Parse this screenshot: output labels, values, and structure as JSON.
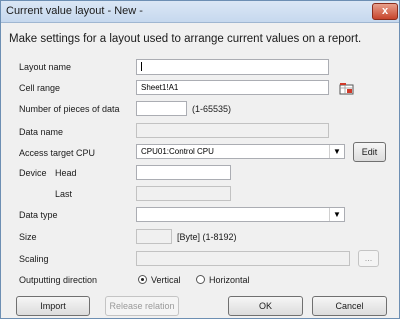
{
  "window": {
    "title": "Current value layout - New -",
    "close_label": "x"
  },
  "description": "Make settings for a layout used to arrange current values on a report.",
  "form": {
    "layout_name": {
      "label": "Layout name",
      "value": ""
    },
    "cell_range": {
      "label": "Cell range",
      "value": "Sheet1!A1"
    },
    "pieces": {
      "label": "Number of pieces of data",
      "value": "",
      "hint": "(1-65535)"
    },
    "data_name": {
      "label": "Data name",
      "value": ""
    },
    "access_cpu": {
      "label": "Access target CPU",
      "value": "CPU01:Control CPU",
      "edit_label": "Edit"
    },
    "device_head": {
      "label_device": "Device",
      "label_head": "Head",
      "value": ""
    },
    "device_last": {
      "label": "Last",
      "value": ""
    },
    "data_type": {
      "label": "Data type",
      "value": ""
    },
    "size": {
      "label": "Size",
      "value": "",
      "hint": "[Byte] (1-8192)"
    },
    "scaling": {
      "label": "Scaling",
      "value": "",
      "browse_label": "..."
    },
    "direction": {
      "label": "Outputting direction",
      "options": [
        "Vertical",
        "Horizontal"
      ],
      "selected": "Vertical"
    }
  },
  "buttons": {
    "import": "Import",
    "release": "Release relation",
    "ok": "OK",
    "cancel": "Cancel"
  },
  "colors": {
    "accent": "#c7442c",
    "icon_red": "#d03a2a"
  }
}
